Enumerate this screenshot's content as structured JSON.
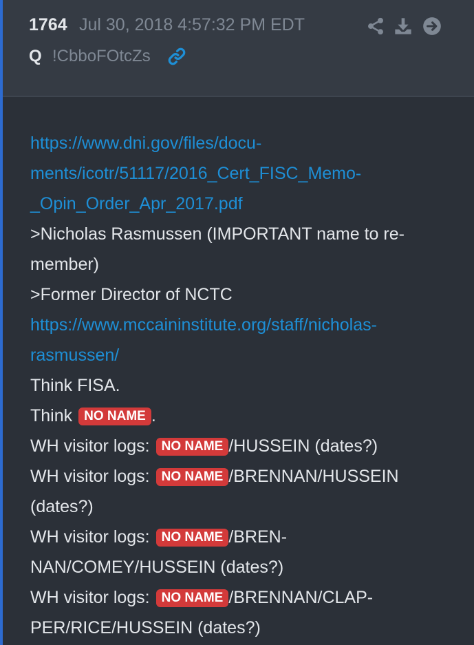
{
  "post": {
    "number": "1764",
    "timestamp": "Jul 30, 2018 4:57:32 PM EDT",
    "author": "Q",
    "tripcode": "!CbboFOtcZs",
    "accent_color": "#2d6bd0",
    "link_color": "#1e8fd6",
    "badge_color": "#d33a3a",
    "icons": {
      "link": "link-icon",
      "share": "share-icon",
      "download": "download-icon",
      "goto": "arrow-circle-right-icon"
    }
  },
  "body": {
    "lines": {
      "l1": "https://www.dni.gov/files/docu-",
      "l2": "ments/icotr/51117/2016_Cert_FISC_Memo-",
      "l3": "_Opin_Order_Apr_2017.pdf",
      "l4": ">Nicholas Rasmussen (IMPORTANT name to re-",
      "l5": "member)",
      "l6": ">Former Director of NCTC",
      "l7": "https://www.mccaininstitute.org/staff/nicholas-",
      "l8": "rasmussen/",
      "l9": "Think FISA.",
      "l10_pre": "Think",
      "l10_post": ".",
      "l11_pre": "WH visitor logs: ",
      "l11_post": "/HUSSEIN (dates?)",
      "l12_pre": "WH visitor logs: ",
      "l12_post": "/BRENNAN/HUSSEIN",
      "l13": "(dates?)",
      "l14_pre": "WH visitor logs: ",
      "l14_post": "/BREN-",
      "l15": "NAN/COMEY/HUSSEIN (dates?)",
      "l16_pre": "WH visitor logs: ",
      "l16_post": "/BRENNAN/CLAP-",
      "l17": "PER/RICE/HUSSEIN (dates?)"
    },
    "badge_label": "NO NAME"
  }
}
